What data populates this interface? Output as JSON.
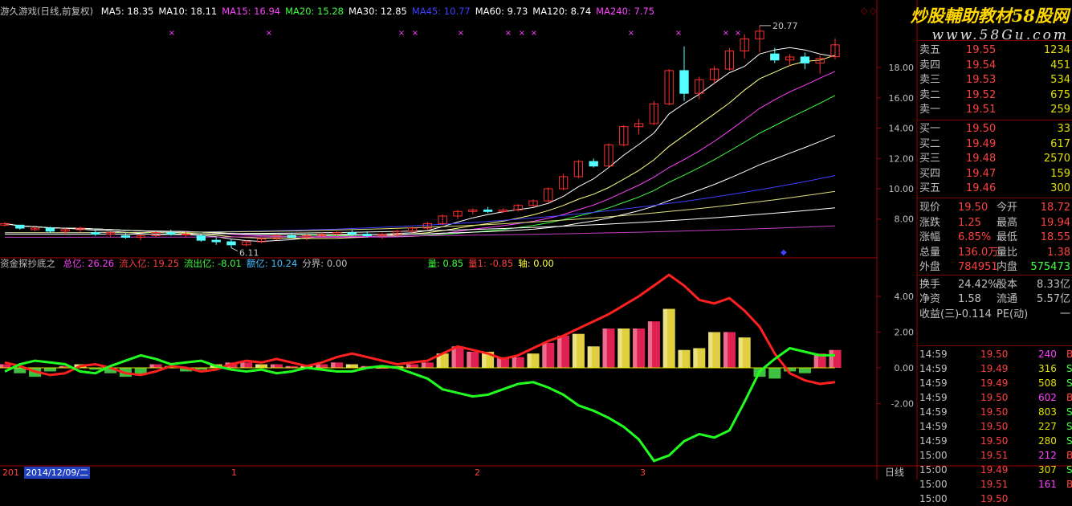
{
  "header": {
    "title": "游久游戏(日线,前复权)",
    "ma": [
      {
        "label": "MA5: 18.35",
        "color": "#ffffff"
      },
      {
        "label": "MA10: 18.11",
        "color": "#ffffff"
      },
      {
        "label": "MA15: 16.94",
        "color": "#ff40ff"
      },
      {
        "label": "MA20: 15.28",
        "color": "#40ff40"
      },
      {
        "label": "MA30: 12.85",
        "color": "#ffffff"
      },
      {
        "label": "MA45: 10.77",
        "color": "#4040ff"
      },
      {
        "label": "MA60: 9.73",
        "color": "#ffffff"
      },
      {
        "label": "MA120: 8.74",
        "color": "#ffffff"
      },
      {
        "label": "MA240: 7.75",
        "color": "#ff40ff"
      }
    ]
  },
  "indicator_header": {
    "name": "资金探抄底之",
    "items": [
      {
        "label": "总亿: 26.26",
        "color": "#ff40ff"
      },
      {
        "label": "流入亿: 19.25",
        "color": "#ff4040"
      },
      {
        "label": "流出亿: -8.01",
        "color": "#40ff40"
      },
      {
        "label": "额亿: 10.24",
        "color": "#40c0ff"
      },
      {
        "label": "分界: 0.00",
        "color": "#c0c0c0"
      }
    ],
    "items2": [
      {
        "label": "量: 0.85",
        "color": "#40ff40"
      },
      {
        "label": "量1: -0.85",
        "color": "#ff4040"
      },
      {
        "label": "轴: 0.00",
        "color": "#ffff40"
      }
    ]
  },
  "logo": {
    "line1": "炒股輔助教材58股网",
    "line2": "www.58Gu.com"
  },
  "bottom": {
    "date": "2014/12/09/二",
    "prefix": "201",
    "months": [
      "1",
      "2",
      "3"
    ],
    "period": "日线"
  },
  "quotes": {
    "sell": [
      [
        "卖五",
        "19.55",
        "1234"
      ],
      [
        "卖四",
        "19.54",
        "451"
      ],
      [
        "卖三",
        "19.53",
        "534"
      ],
      [
        "卖二",
        "19.52",
        "675"
      ],
      [
        "卖一",
        "19.51",
        "259"
      ]
    ],
    "buy": [
      [
        "买一",
        "19.50",
        "33"
      ],
      [
        "买二",
        "19.49",
        "617"
      ],
      [
        "买三",
        "19.48",
        "2570"
      ],
      [
        "买四",
        "19.47",
        "159"
      ],
      [
        "买五",
        "19.46",
        "300"
      ]
    ],
    "stats": [
      [
        "现价",
        "19.50",
        "今开",
        "18.72"
      ],
      [
        "涨跌",
        "1.25",
        "最高",
        "19.94"
      ],
      [
        "涨幅",
        "6.85%",
        "最低",
        "18.55"
      ],
      [
        "总量",
        "136.0万",
        "量比",
        "1.38"
      ],
      [
        "外盘",
        "784951",
        "内盘",
        "575473"
      ],
      [
        "换手",
        "24.42%",
        "股本",
        "8.33亿"
      ],
      [
        "净资",
        "1.58",
        "流通",
        "5.57亿"
      ],
      [
        "收益(三)",
        "-0.114",
        "PE(动)",
        "一"
      ]
    ],
    "trades": [
      [
        "14:59",
        "19.50",
        "240",
        "B"
      ],
      [
        "14:59",
        "19.49",
        "316",
        "S"
      ],
      [
        "14:59",
        "19.49",
        "508",
        "S"
      ],
      [
        "14:59",
        "19.50",
        "602",
        "B"
      ],
      [
        "14:59",
        "19.50",
        "803",
        "S"
      ],
      [
        "14:59",
        "19.50",
        "227",
        "S"
      ],
      [
        "14:59",
        "19.50",
        "280",
        "S"
      ],
      [
        "15:00",
        "19.51",
        "212",
        "B"
      ],
      [
        "15:00",
        "19.49",
        "307",
        "S"
      ],
      [
        "15:00",
        "19.51",
        "161",
        "B"
      ],
      [
        "15:00",
        "19.50",
        "",
        ""
      ]
    ]
  },
  "chart_data": [
    {
      "type": "candlestick",
      "title": "游久游戏(日线,前复权)",
      "yticks": [
        8.0,
        10.0,
        12.0,
        14.0,
        16.0,
        18.0
      ],
      "ylim": [
        5.6,
        21.4
      ],
      "annotations": [
        {
          "label": "20.77"
        },
        {
          "label": "6.11"
        }
      ],
      "candles": [
        [
          7.6,
          7.8,
          7.5,
          7.7
        ],
        [
          7.6,
          7.6,
          7.3,
          7.4
        ],
        [
          7.3,
          7.5,
          7.2,
          7.4
        ],
        [
          7.4,
          7.5,
          7.1,
          7.2
        ],
        [
          7.2,
          7.4,
          7.0,
          7.3
        ],
        [
          7.3,
          7.5,
          7.1,
          7.4
        ],
        [
          7.1,
          7.3,
          6.9,
          7.0
        ],
        [
          7.0,
          7.2,
          6.8,
          7.1
        ],
        [
          6.9,
          7.1,
          6.7,
          6.8
        ],
        [
          6.8,
          7.0,
          6.6,
          6.9
        ],
        [
          6.9,
          7.2,
          6.8,
          7.1
        ],
        [
          7.1,
          7.3,
          6.9,
          7.0
        ],
        [
          7.0,
          7.2,
          6.8,
          7.0
        ],
        [
          6.9,
          7.0,
          6.5,
          6.6
        ],
        [
          6.6,
          6.8,
          6.3,
          6.5
        ],
        [
          6.5,
          6.7,
          6.1,
          6.3
        ],
        [
          6.3,
          6.6,
          6.2,
          6.5
        ],
        [
          6.5,
          6.8,
          6.4,
          6.7
        ],
        [
          6.7,
          7.0,
          6.6,
          6.9
        ],
        [
          6.9,
          7.1,
          6.7,
          6.8
        ],
        [
          6.8,
          7.0,
          6.6,
          6.9
        ],
        [
          6.9,
          7.1,
          6.8,
          7.0
        ],
        [
          7.0,
          7.2,
          6.9,
          7.1
        ],
        [
          7.1,
          7.3,
          6.9,
          7.0
        ],
        [
          7.0,
          7.2,
          6.8,
          6.9
        ],
        [
          6.9,
          7.1,
          6.7,
          7.0
        ],
        [
          7.0,
          7.3,
          6.9,
          7.2
        ],
        [
          7.2,
          7.5,
          7.1,
          7.4
        ],
        [
          7.4,
          7.8,
          7.3,
          7.7
        ],
        [
          7.7,
          8.3,
          7.6,
          8.2
        ],
        [
          8.2,
          8.6,
          8.0,
          8.5
        ],
        [
          8.5,
          8.7,
          8.3,
          8.6
        ],
        [
          8.6,
          8.8,
          8.4,
          8.5
        ],
        [
          8.5,
          8.7,
          8.4,
          8.6
        ],
        [
          8.6,
          9.0,
          8.5,
          8.9
        ],
        [
          8.9,
          9.3,
          8.8,
          9.2
        ],
        [
          9.2,
          10.1,
          9.1,
          10.0
        ],
        [
          10.0,
          11.0,
          9.9,
          10.8
        ],
        [
          10.8,
          11.9,
          10.7,
          11.8
        ],
        [
          11.8,
          12.0,
          11.4,
          11.5
        ],
        [
          11.5,
          13.0,
          11.4,
          12.9
        ],
        [
          12.9,
          14.2,
          12.8,
          14.1
        ],
        [
          14.1,
          14.6,
          13.6,
          14.3
        ],
        [
          14.3,
          15.8,
          14.2,
          15.6
        ],
        [
          15.6,
          17.9,
          15.5,
          17.8
        ],
        [
          17.8,
          19.4,
          15.8,
          16.3
        ],
        [
          16.3,
          17.4,
          15.9,
          17.2
        ],
        [
          17.2,
          18.1,
          16.9,
          17.9
        ],
        [
          17.9,
          19.3,
          17.8,
          19.1
        ],
        [
          19.1,
          20.2,
          18.6,
          19.9
        ],
        [
          19.9,
          20.77,
          19.0,
          20.4
        ],
        [
          18.9,
          19.3,
          18.3,
          18.5
        ],
        [
          18.5,
          18.9,
          18.1,
          18.7
        ],
        [
          18.7,
          19.0,
          17.9,
          18.3
        ],
        [
          18.3,
          18.8,
          17.6,
          18.6
        ],
        [
          18.72,
          19.94,
          18.55,
          19.5
        ]
      ]
    },
    {
      "type": "line",
      "title": "资金探抄底之",
      "yticks": [
        -2.0,
        0.0,
        2.0,
        4.0
      ],
      "ylim": [
        -5.3,
        5.3
      ],
      "series": [
        {
          "name": "流入亿",
          "color": "#ff2020",
          "values": [
            0.3,
            0.1,
            -0.2,
            -0.4,
            -0.3,
            0.1,
            0.2,
            0.0,
            -0.3,
            -0.4,
            -0.2,
            0.1,
            0.0,
            -0.2,
            -0.1,
            0.2,
            0.4,
            0.3,
            0.5,
            0.3,
            0.1,
            0.3,
            0.6,
            0.8,
            0.6,
            0.4,
            0.2,
            0.3,
            0.4,
            0.8,
            1.2,
            1.0,
            0.8,
            0.5,
            0.7,
            1.1,
            1.5,
            1.8,
            2.2,
            2.6,
            3.0,
            3.5,
            4.0,
            4.6,
            5.2,
            4.6,
            3.8,
            3.6,
            3.9,
            3.2,
            2.3,
            0.8,
            -0.3,
            -0.7,
            -0.9,
            -0.8
          ]
        },
        {
          "name": "流出亿",
          "color": "#20ff20",
          "values": [
            -0.2,
            0.2,
            0.4,
            0.3,
            0.2,
            -0.2,
            -0.3,
            0.1,
            0.4,
            0.7,
            0.5,
            0.2,
            0.3,
            0.4,
            0.1,
            -0.1,
            -0.2,
            -0.1,
            -0.3,
            -0.2,
            0.0,
            -0.1,
            -0.2,
            -0.2,
            0.0,
            0.1,
            0.0,
            -0.3,
            -0.6,
            -1.2,
            -1.4,
            -1.6,
            -1.5,
            -1.2,
            -0.9,
            -0.8,
            -1.1,
            -1.5,
            -2.1,
            -2.4,
            -2.8,
            -3.3,
            -4.0,
            -5.2,
            -4.9,
            -4.1,
            -3.7,
            -3.9,
            -3.5,
            -1.9,
            -0.2,
            0.5,
            1.1,
            0.9,
            0.7,
            0.7
          ]
        },
        {
          "name": "量",
          "type": "bar",
          "values": [
            0.2,
            -0.3,
            -0.5,
            -0.2,
            0.1,
            0.2,
            -0.1,
            -0.3,
            -0.5,
            -0.4,
            0.2,
            0.1,
            -0.2,
            -0.1,
            0.2,
            0.3,
            0.3,
            0.2,
            0.2,
            0.1,
            0.1,
            0.2,
            0.3,
            0.2,
            0.1,
            0.0,
            0.1,
            0.2,
            0.3,
            0.8,
            1.2,
            0.9,
            0.9,
            0.6,
            0.6,
            0.8,
            1.4,
            1.8,
            1.9,
            1.2,
            2.2,
            2.2,
            2.2,
            2.6,
            3.3,
            1.0,
            1.1,
            2.0,
            2.0,
            1.7,
            -0.5,
            -0.6,
            -0.2,
            -0.3,
            0.8,
            1.0
          ]
        }
      ]
    }
  ]
}
